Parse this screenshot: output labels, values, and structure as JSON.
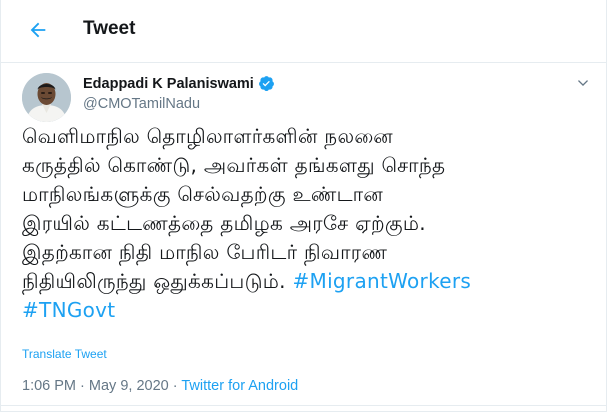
{
  "header": {
    "title": "Tweet"
  },
  "author": {
    "name": "Edappadi K Palaniswami",
    "handle": "@CMOTamilNadu",
    "verified": true
  },
  "tweet": {
    "lines": [
      "வெளிமாநில தொழிலாளர்களின் நலனை",
      "கருத்தில் கொண்டு, அவர்கள் தங்களது சொந்த",
      "மாநிலங்களுக்கு செல்வதற்கு உண்டான",
      "இரயில் கட்டணத்தை தமிழக அரசே ஏற்கும்.",
      "இதற்கான நிதி மாநில பேரிடர் நிவாரண",
      "நிதியிலிருந்து ஒதுக்கப்படும்."
    ],
    "hashtags": [
      "#MigrantWorkers",
      "#TNGovt"
    ]
  },
  "translate_label": "Translate Tweet",
  "meta": {
    "time": "1:06 PM",
    "separator": "·",
    "date": "May 9, 2020",
    "source": "Twitter for Android"
  },
  "colors": {
    "accent": "#1da1f2",
    "text": "#14171a",
    "secondary": "#657786",
    "border": "#e6ecf0"
  },
  "icons": {
    "back": "arrow-left-icon",
    "verified": "verified-badge-icon",
    "more": "chevron-down-icon"
  }
}
